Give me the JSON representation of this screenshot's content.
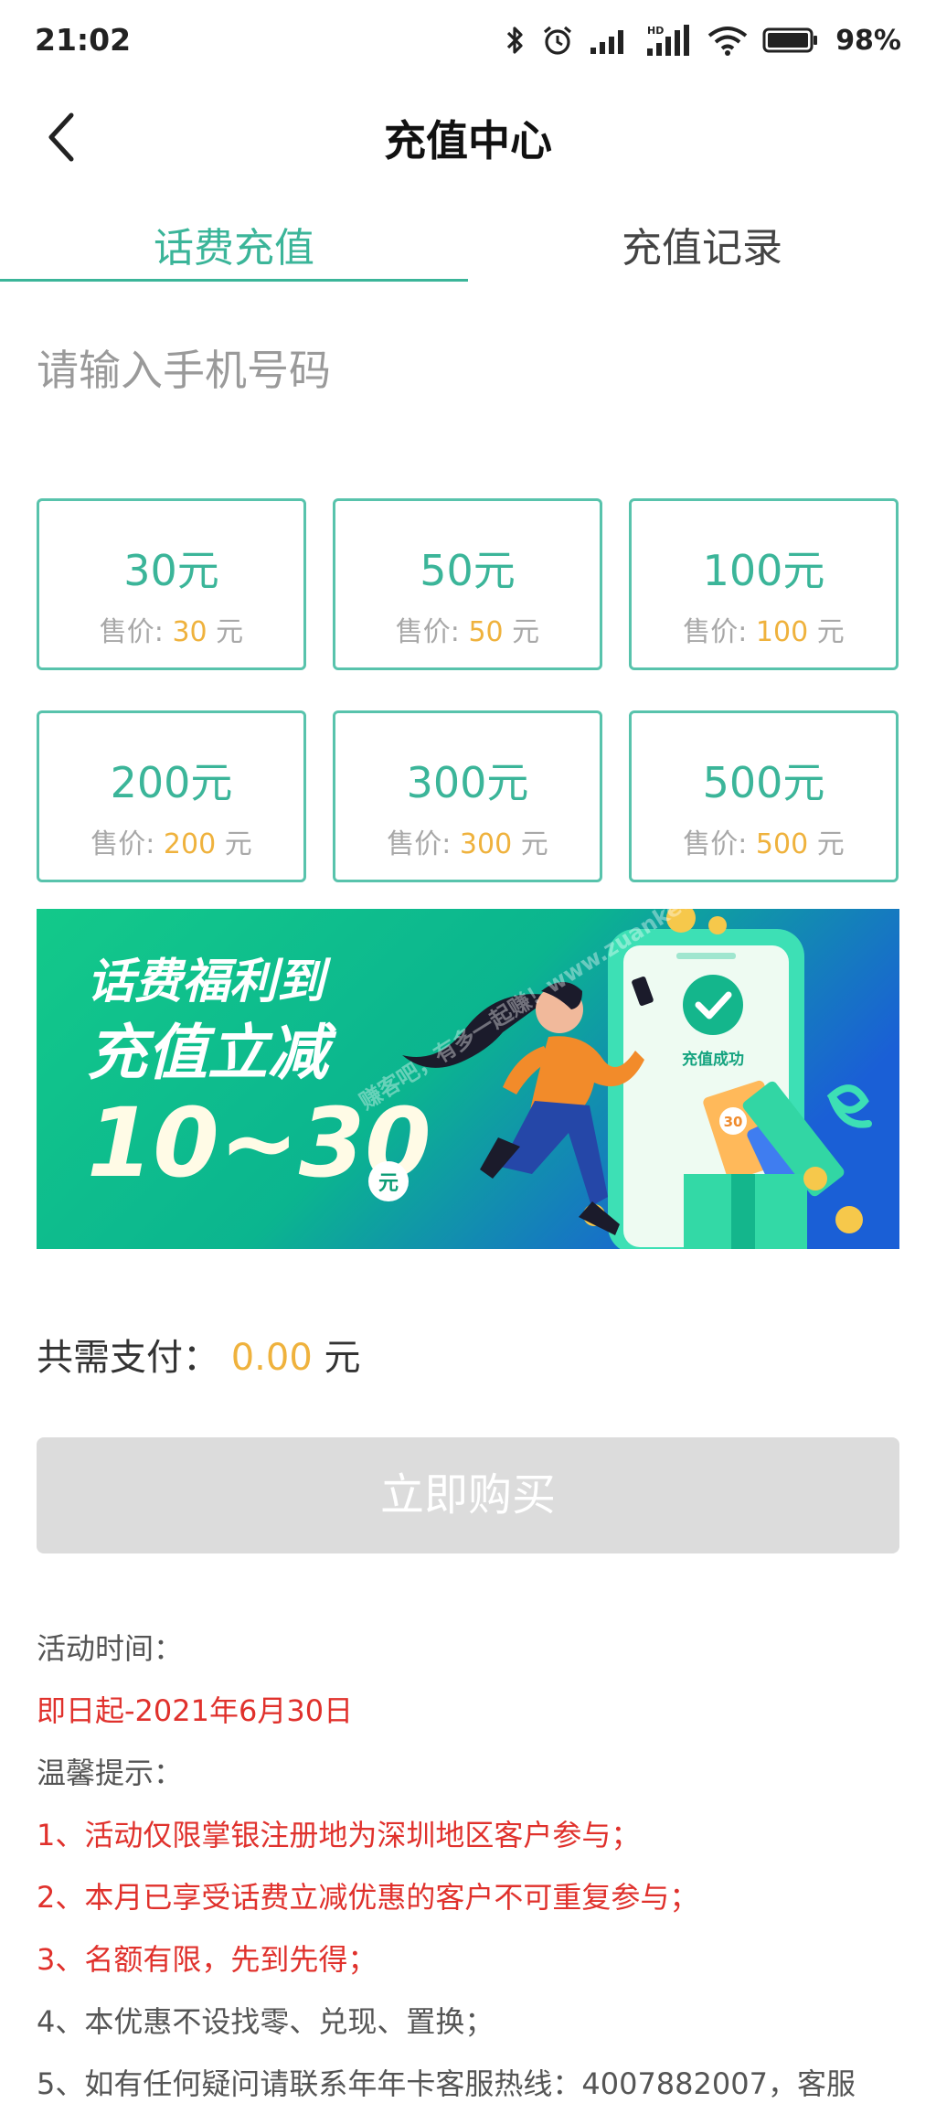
{
  "status_bar": {
    "time": "21:02",
    "battery": "98%",
    "icons": [
      "bluetooth-icon",
      "alarm-icon",
      "cell-signal-icon",
      "hd-signal-icon",
      "wifi-icon",
      "battery-icon"
    ]
  },
  "header": {
    "title": "充值中心",
    "back_icon": "back-chevron-icon"
  },
  "tabs": [
    {
      "label": "话费充值",
      "active": true
    },
    {
      "label": "充值记录",
      "active": false
    }
  ],
  "phone_input": {
    "placeholder": "请输入手机号码",
    "value": ""
  },
  "price_prefix": "售价: ",
  "price_suffix": " 元",
  "options": [
    {
      "amount": "30元",
      "price": "30"
    },
    {
      "amount": "50元",
      "price": "50"
    },
    {
      "amount": "100元",
      "price": "100"
    },
    {
      "amount": "200元",
      "price": "200"
    },
    {
      "amount": "300元",
      "price": "300"
    },
    {
      "amount": "500元",
      "price": "500"
    }
  ],
  "banner": {
    "line1": "话费福利到",
    "line2": "充值立减",
    "range": "10~30",
    "unit": "元",
    "success_text": "充值成功",
    "coupon_value": "30",
    "watermark": "赚客吧，有多一起赚！www.zuanke8.com"
  },
  "total": {
    "label": "共需支付：",
    "amount": "0.00",
    "unit": " 元"
  },
  "buy_button": "立即购买",
  "info": {
    "activity_time_label": "活动时间：",
    "activity_time": "即日起-2021年6月30日",
    "tips_label": "温馨提示：",
    "tip1": "1、活动仅限掌银注册地为深圳地区客户参与；",
    "tip2": "2、本月已享受话费立减优惠的客户不可重复参与；",
    "tip3": "3、名额有限，先到先得；",
    "tip4": "4、本优惠不设找零、兑现、置换；",
    "tip5": "5、如有任何疑问请联系年年卡客服热线：4007882007，客服"
  },
  "colors": {
    "accent": "#3bb599",
    "card_border": "#58c3ac",
    "price": "#efb23d",
    "red_text": "#e0312c",
    "disabled_button": "#dcdcdc"
  }
}
